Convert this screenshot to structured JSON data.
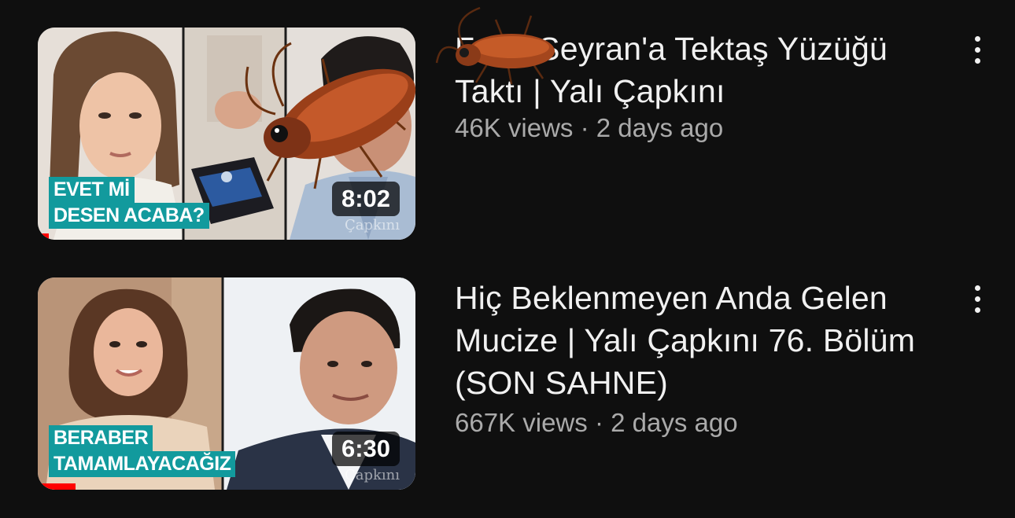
{
  "videos": [
    {
      "title": "Ferit, Seyran'a Tektaş Yüzüğü Taktı | Yalı Çapkını",
      "views": "46K views",
      "separator": "·",
      "age": "2 days ago",
      "duration": "8:02",
      "caption_lines": [
        "EVET Mİ",
        "DESEN ACABA?"
      ],
      "watermark": "Çapkını",
      "watch_progress": 0.03
    },
    {
      "title": "Hiç Beklenmeyen Anda Gelen Mucize | Yalı Çapkını 76. Bölüm (SON SAHNE)",
      "views": "667K views",
      "separator": "·",
      "age": "2 days ago",
      "duration": "6:30",
      "caption_lines": [
        "BERABER",
        "TAMAMLAYACAĞIZ"
      ],
      "watermark": "Çapkını",
      "watch_progress": 0.1
    }
  ],
  "icons": {
    "more": "vertical-ellipsis-icon",
    "sticker": "cockroach-sticker"
  },
  "colors": {
    "background": "#0f0f0f",
    "title": "#f1f1f1",
    "meta": "#aaaaaa",
    "caption_bg": "#129a9d",
    "progress": "#ff0000"
  }
}
